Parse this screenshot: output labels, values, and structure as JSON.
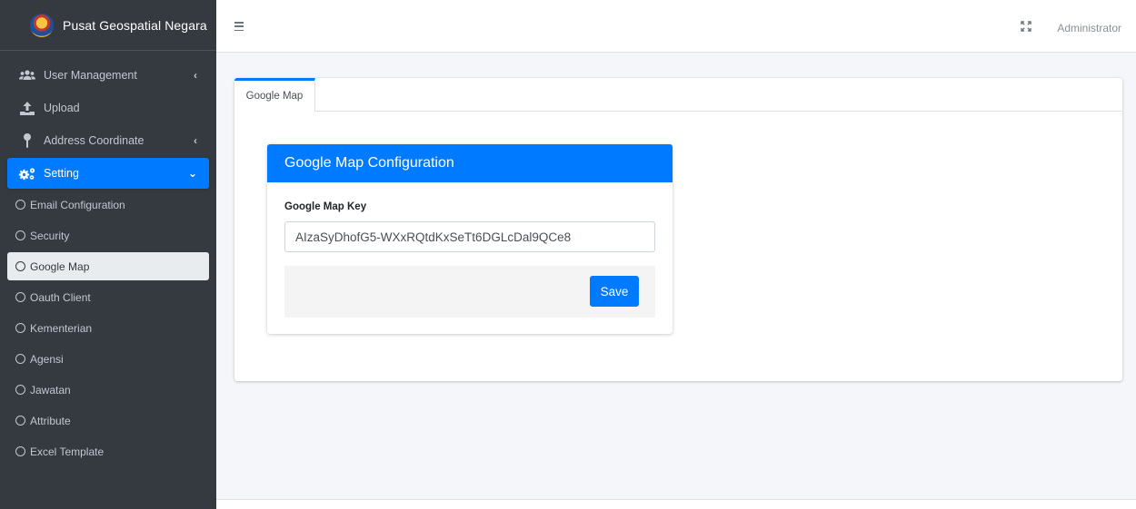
{
  "brand": {
    "name": "Pusat Geospatial Negara"
  },
  "sidebar": {
    "items": [
      {
        "label": "User Management",
        "icon": "users-icon",
        "has_submenu": true
      },
      {
        "label": "Upload",
        "icon": "upload-icon",
        "has_submenu": false
      },
      {
        "label": "Address Coordinate",
        "icon": "map-pin-icon",
        "has_submenu": true
      },
      {
        "label": "Setting",
        "icon": "cogs-icon",
        "has_submenu": true,
        "active": true
      }
    ],
    "setting_subitems": [
      {
        "label": "Email Configuration"
      },
      {
        "label": "Security"
      },
      {
        "label": "Google Map",
        "selected": true
      },
      {
        "label": "Oauth Client"
      },
      {
        "label": "Kementerian"
      },
      {
        "label": "Agensi"
      },
      {
        "label": "Jawatan"
      },
      {
        "label": "Attribute"
      },
      {
        "label": "Excel Template"
      }
    ]
  },
  "header": {
    "user": "Administrator"
  },
  "main": {
    "tabs": [
      {
        "label": "Google Map",
        "active": true
      }
    ],
    "card": {
      "title": "Google Map Configuration",
      "field_label": "Google Map Key",
      "field_value": "AIzaSyDhofG5-WXxRQtdKxSeTt6DGLcDal9QCe8",
      "save_label": "Save"
    }
  },
  "colors": {
    "sidebar_bg": "#343a40",
    "accent": "#007bff",
    "content_bg": "#f4f6f9"
  }
}
